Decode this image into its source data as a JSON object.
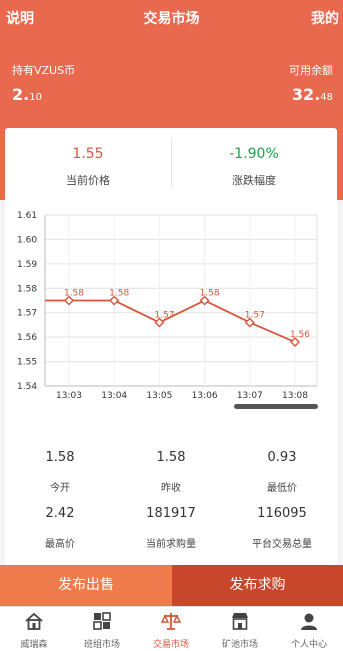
{
  "header": {
    "left": "说明",
    "title": "交易市场",
    "right": "我的"
  },
  "balance": {
    "holding_label": "持有VZUS币",
    "holding_int": "2.",
    "holding_dec": "10",
    "available_label": "可用余额",
    "available_int": "32.",
    "available_dec": "48"
  },
  "summary": {
    "price_value": "1.55",
    "price_label": "当前价格",
    "change_value": "-1.90%",
    "change_label": "涨跌幅度"
  },
  "chart_data": {
    "type": "line",
    "x": [
      "13:03",
      "13:04",
      "13:05",
      "13:06",
      "13:07",
      "13:08"
    ],
    "values": [
      1.575,
      1.575,
      1.566,
      1.575,
      1.566,
      1.558
    ],
    "point_labels": [
      "1.58",
      "1.58",
      "1.57",
      "1.58",
      "1.57",
      "1.56"
    ],
    "start_value": 1.575,
    "ylim": [
      1.54,
      1.61
    ],
    "yticks": [
      "1.61",
      "1.60",
      "1.59",
      "1.58",
      "1.57",
      "1.56",
      "1.55",
      "1.54"
    ],
    "grid": true,
    "color": "#d9553a"
  },
  "stats": [
    {
      "value": "1.58",
      "label": "今开"
    },
    {
      "value": "1.58",
      "label": "昨收"
    },
    {
      "value": "0.93",
      "label": "最低价"
    },
    {
      "value": "2.42",
      "label": "最高价"
    },
    {
      "value": "181917",
      "label": "当前求购量"
    },
    {
      "value": "116095",
      "label": "平台交易总量"
    }
  ],
  "actions": {
    "sell_label": "发布出售",
    "buy_label": "发布求购"
  },
  "tabs": [
    {
      "label": "威瑞森",
      "icon": "home-icon"
    },
    {
      "label": "班组市场",
      "icon": "grid-icon"
    },
    {
      "label": "交易市场",
      "icon": "scale-icon"
    },
    {
      "label": "矿池市场",
      "icon": "store-icon"
    },
    {
      "label": "个人中心",
      "icon": "user-icon"
    }
  ],
  "colors": {
    "brand": "#e8694d",
    "negative": "#1aa34a",
    "price": "#d9553a"
  }
}
